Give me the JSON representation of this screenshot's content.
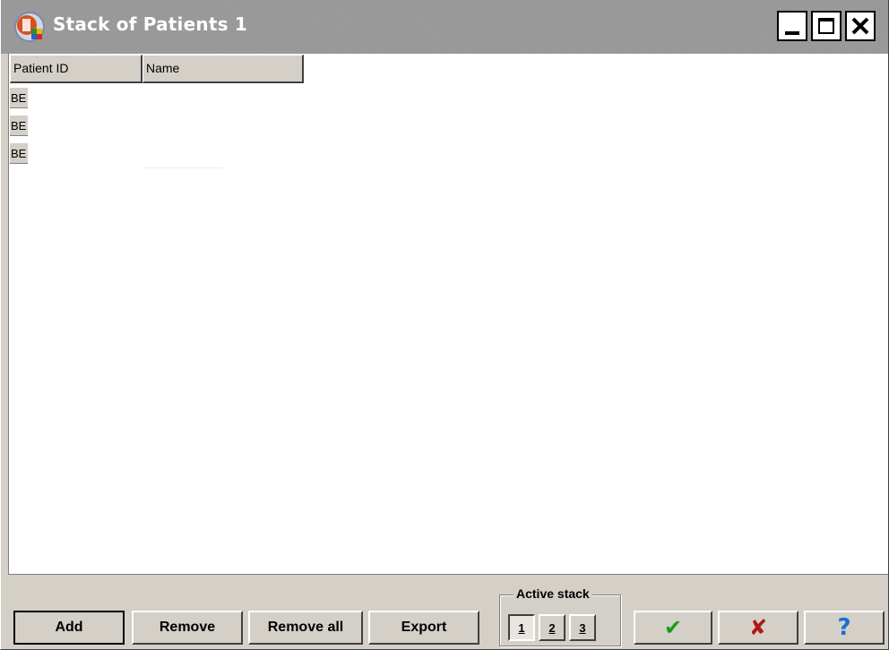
{
  "window": {
    "title": "Stack of Patients 1",
    "app_icon": "patients-app-icon",
    "controls": {
      "minimize_icon": "minimize-icon",
      "maximize_icon": "maximize-icon",
      "close_icon": "close-icon"
    }
  },
  "table": {
    "columns": [
      "Patient ID",
      "Name"
    ],
    "rows": [
      {
        "patient_id": "BE",
        "name": ""
      },
      {
        "patient_id": "BE",
        "name": ""
      },
      {
        "patient_id": "BE",
        "name": ""
      }
    ]
  },
  "buttons": {
    "add": "Add",
    "remove": "Remove",
    "remove_all": "Remove all",
    "export": "Export"
  },
  "active_stack": {
    "label": "Active stack",
    "options": [
      "1",
      "2",
      "3"
    ],
    "selected": "1"
  },
  "dialog_buttons": {
    "ok_icon": "checkmark-icon",
    "cancel_icon": "cross-icon",
    "help_icon": "question-icon",
    "ok_glyph": "✔",
    "cancel_glyph": "✘",
    "help_glyph": "?"
  },
  "colors": {
    "ok": "#1a9a1a",
    "cancel": "#b01818",
    "help": "#1c6fd0"
  }
}
